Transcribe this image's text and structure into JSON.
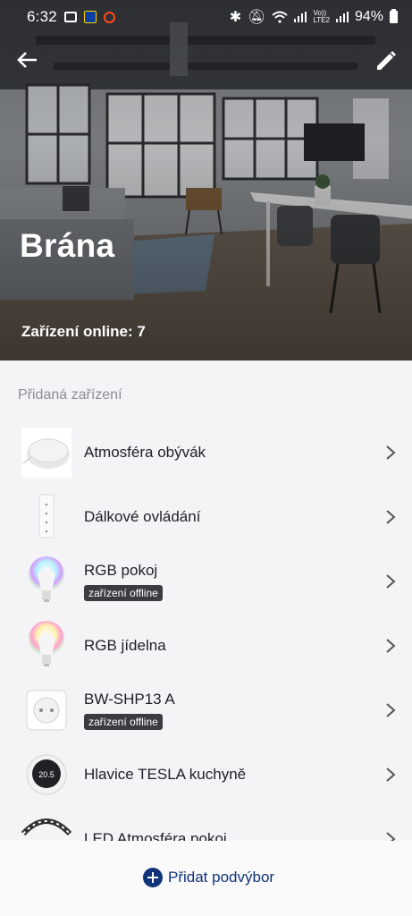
{
  "status_bar": {
    "time": "6:32",
    "network": "Vo))\nLTE2",
    "battery": "94%"
  },
  "header": {
    "title": "Brána",
    "online_label": "Zařízení online: 7"
  },
  "section": {
    "label": "Přidaná zařízení"
  },
  "devices": [
    {
      "name": "Atmosféra obývák",
      "status": "",
      "icon": "hub-device-icon"
    },
    {
      "name": "Dálkové ovládání",
      "status": "",
      "icon": "remote-control-icon"
    },
    {
      "name": "RGB pokoj",
      "status": "zařízení offline",
      "icon": "rgb-bulb-icon"
    },
    {
      "name": "RGB jídelna",
      "status": "",
      "icon": "rgb-bulb-icon"
    },
    {
      "name": "BW-SHP13 A",
      "status": "zařízení offline",
      "icon": "smart-plug-icon"
    },
    {
      "name": "Hlavice TESLA kuchyně",
      "status": "",
      "icon": "thermostat-head-icon",
      "display_value": "20.5"
    },
    {
      "name": "LED Atmosféra pokoj",
      "status": "",
      "icon": "led-strip-icon"
    }
  ],
  "footer": {
    "add_label": "Přidat podvýbor"
  },
  "colors": {
    "accent": "#10337a",
    "badge_bg": "#3b3b40",
    "list_bg": "#f4f4f6"
  }
}
